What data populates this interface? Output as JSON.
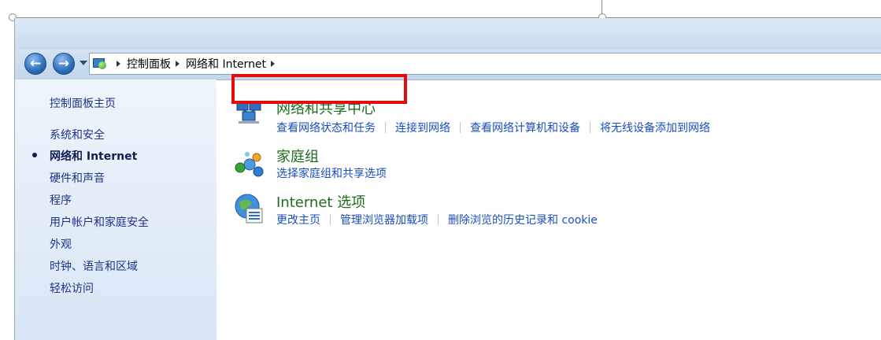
{
  "breadcrumb": [
    "控制面板",
    "网络和 Internet"
  ],
  "sidebar": {
    "home": "控制面板主页",
    "items": [
      "系统和安全",
      "网络和 Internet",
      "硬件和声音",
      "程序",
      "用户帐户和家庭安全",
      "外观",
      "时钟、语言和区域",
      "轻松访问"
    ],
    "active_index": 1
  },
  "categories": [
    {
      "title": "网络和共享中心",
      "icon": "network-sharing-center-icon",
      "links": [
        "查看网络状态和任务",
        "连接到网络",
        "查看网络计算机和设备",
        "将无线设备添加到网络"
      ]
    },
    {
      "title": "家庭组",
      "icon": "homegroup-icon",
      "links": [
        "选择家庭组和共享选项"
      ]
    },
    {
      "title": "Internet 选项",
      "icon": "internet-options-icon",
      "links": [
        "更改主页",
        "管理浏览器加载项",
        "删除浏览的历史记录和 cookie"
      ]
    }
  ],
  "colors": {
    "highlight_box": "#e60b0b",
    "category_title": "#1d6b1d",
    "link": "#1a4dbd"
  }
}
